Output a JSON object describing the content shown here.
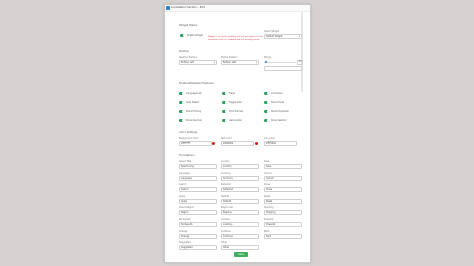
{
  "window": {
    "title": "Localization Section – Edit"
  },
  "widget_status": {
    "title": "Widget Status",
    "toggle_label": "Enable Widget",
    "warning_lines": [
      "Widget is currently disabled and will not appear on the",
      "storefront until it is enabled and the settings saved."
    ],
    "layout_label": "Select Widget",
    "layout_value": "Default Widget"
  },
  "position": {
    "title": "Position",
    "label_1": "Desktop Position",
    "value_1": "Bottom Left",
    "label_2": "Mobile Position",
    "value_2": "Bottom Left",
    "label_3": "Margin",
    "value_3": "20"
  },
  "enabled_features": {
    "title": "Enabled/Disabled Features",
    "items": [
      "Language List",
      "Flags",
      "Currencies",
      "Auto Detect",
      "Toggle View",
      "Show Prices",
      "Round Pricing",
      "Price Format",
      "Show Dropdown",
      "Show Decimal",
      "Geolocation",
      "Show Selector"
    ]
  },
  "color_settings": {
    "title": "Color Settings",
    "labels": [
      "Background Color",
      "Text Color",
      "Icon Color"
    ],
    "values": [
      "#FFFFFF",
      "#000000",
      "#FF0000"
    ]
  },
  "translations": {
    "title": "Translations",
    "rows": [
      [
        {
          "label": "Select Title",
          "value": "Select Lang"
        },
        {
          "label": "Country",
          "value": "Country"
        },
        {
          "label": "Save",
          "value": "Save"
        }
      ],
      [
        {
          "label": "Language",
          "value": "Language"
        },
        {
          "label": "Currency",
          "value": "Currency"
        },
        {
          "label": "Cancel",
          "value": "Cancel"
        }
      ],
      [
        {
          "label": "Search",
          "value": "Search"
        },
        {
          "label": "Detected",
          "value": "Detected"
        },
        {
          "label": "Close",
          "value": "Close"
        }
      ],
      [
        {
          "label": "Apply",
          "value": "Apply"
        },
        {
          "label": "Default",
          "value": "Default"
        },
        {
          "label": "Reset",
          "value": "Reset"
        }
      ],
      [
        {
          "label": "Select Region",
          "value": "Region"
        },
        {
          "label": "Region List",
          "value": "Regions"
        },
        {
          "label": "Shipping",
          "value": "Shipping"
        }
      ],
      [
        {
          "label": "No Results",
          "value": "No Results"
        },
        {
          "label": "Loading",
          "value": "Loading..."
        },
        {
          "label": "Powered",
          "value": "Powered"
        }
      ],
      [
        {
          "label": "Change",
          "value": "Change"
        },
        {
          "label": "Continue",
          "value": "Continue"
        },
        {
          "label": "Back",
          "value": "Back"
        }
      ],
      [
        {
          "label": "Suggested",
          "value": "Suggested"
        },
        {
          "label": "Other",
          "value": "Other"
        },
        {
          "label": "",
          "value": ""
        }
      ]
    ]
  },
  "save_label": "Save"
}
